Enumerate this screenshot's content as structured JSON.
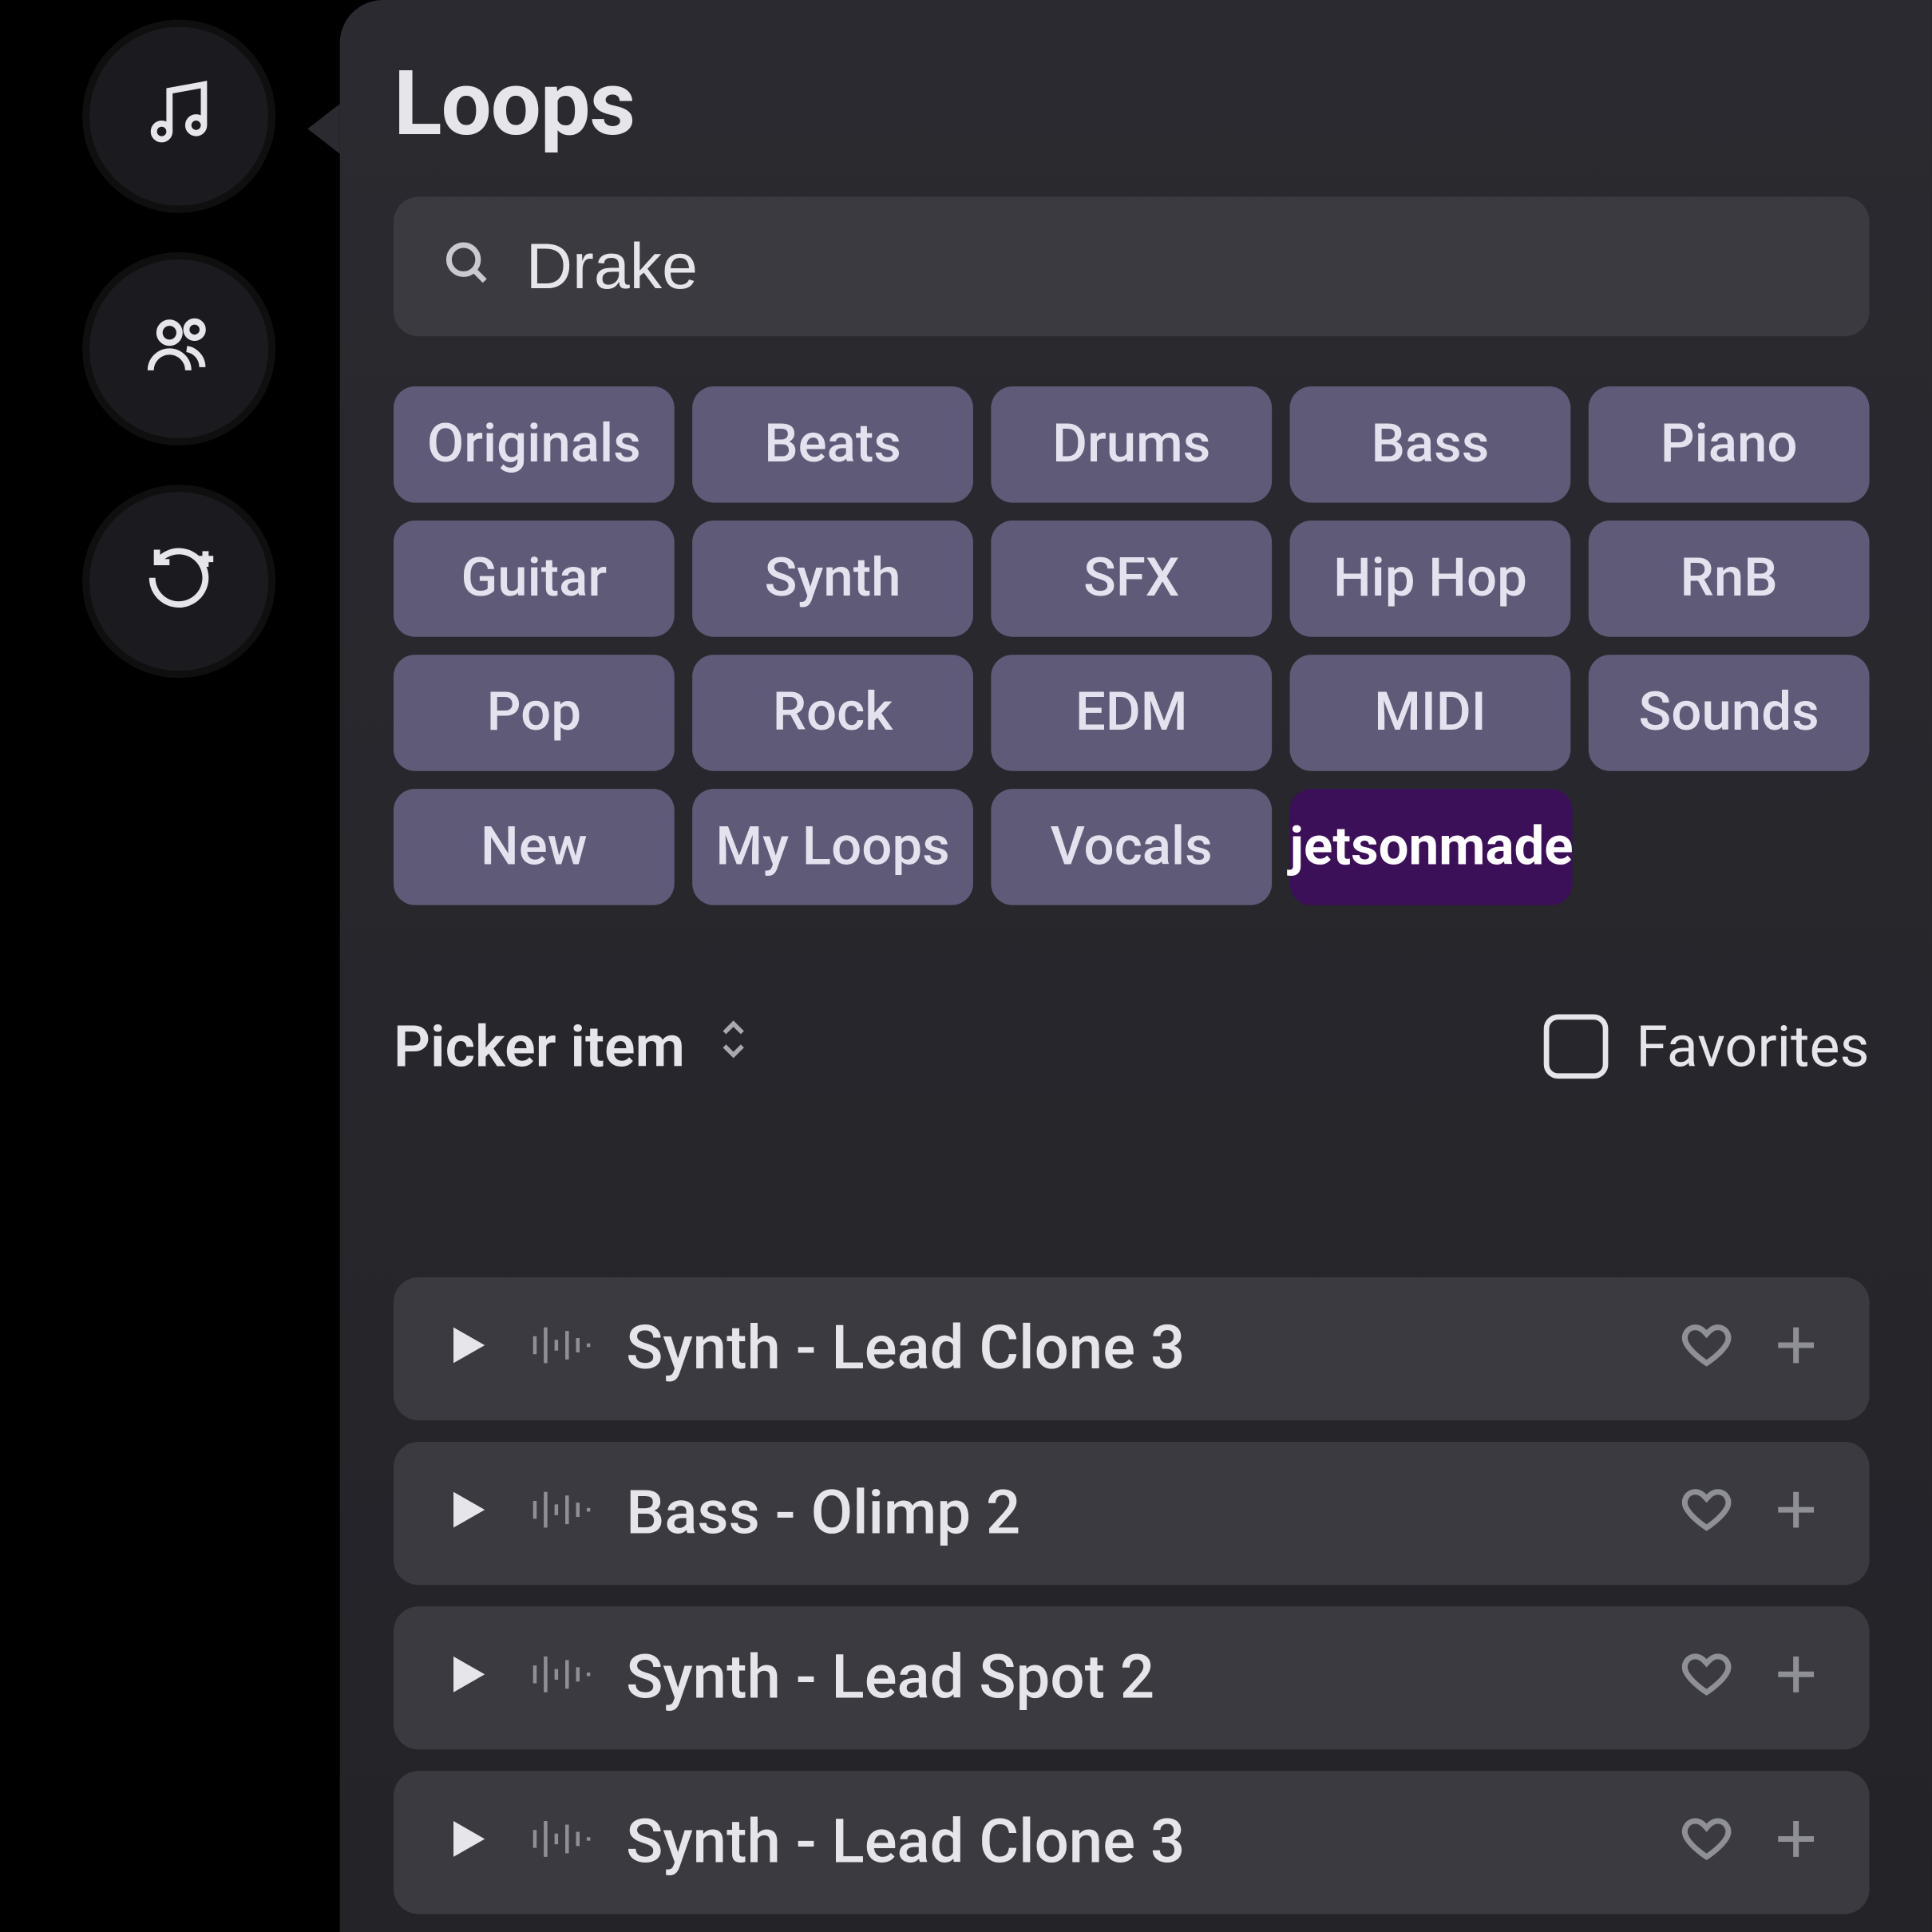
{
  "title": "Loops",
  "search": {
    "value": "Drake"
  },
  "tags": [
    {
      "label": "Originals",
      "accent": false
    },
    {
      "label": "Beats",
      "accent": false
    },
    {
      "label": "Drums",
      "accent": false
    },
    {
      "label": "Bass",
      "accent": false
    },
    {
      "label": "Piano",
      "accent": false
    },
    {
      "label": "Guitar",
      "accent": false
    },
    {
      "label": "Synth",
      "accent": false
    },
    {
      "label": "SFX",
      "accent": false
    },
    {
      "label": "Hip Hop",
      "accent": false
    },
    {
      "label": "RnB",
      "accent": false
    },
    {
      "label": "Pop",
      "accent": false
    },
    {
      "label": "Rock",
      "accent": false
    },
    {
      "label": "EDM",
      "accent": false
    },
    {
      "label": "MIDI",
      "accent": false
    },
    {
      "label": "Sounds",
      "accent": false
    },
    {
      "label": "New",
      "accent": false
    },
    {
      "label": "My Loops",
      "accent": false
    },
    {
      "label": "Vocals",
      "accent": false
    },
    {
      "label": "jetsonmade",
      "accent": true
    }
  ],
  "picker": {
    "label": "Picker item"
  },
  "favorites": {
    "label": "Favorites",
    "checked": false
  },
  "tracks": [
    {
      "title": "Synth - Lead Clone 3"
    },
    {
      "title": "Bass - Olimp 2"
    },
    {
      "title": "Synth - Lead Spot 2"
    },
    {
      "title": "Synth - Lead Clone 3"
    }
  ],
  "sideIcons": [
    "music-note-icon",
    "people-icon",
    "loop-plus-icon"
  ]
}
